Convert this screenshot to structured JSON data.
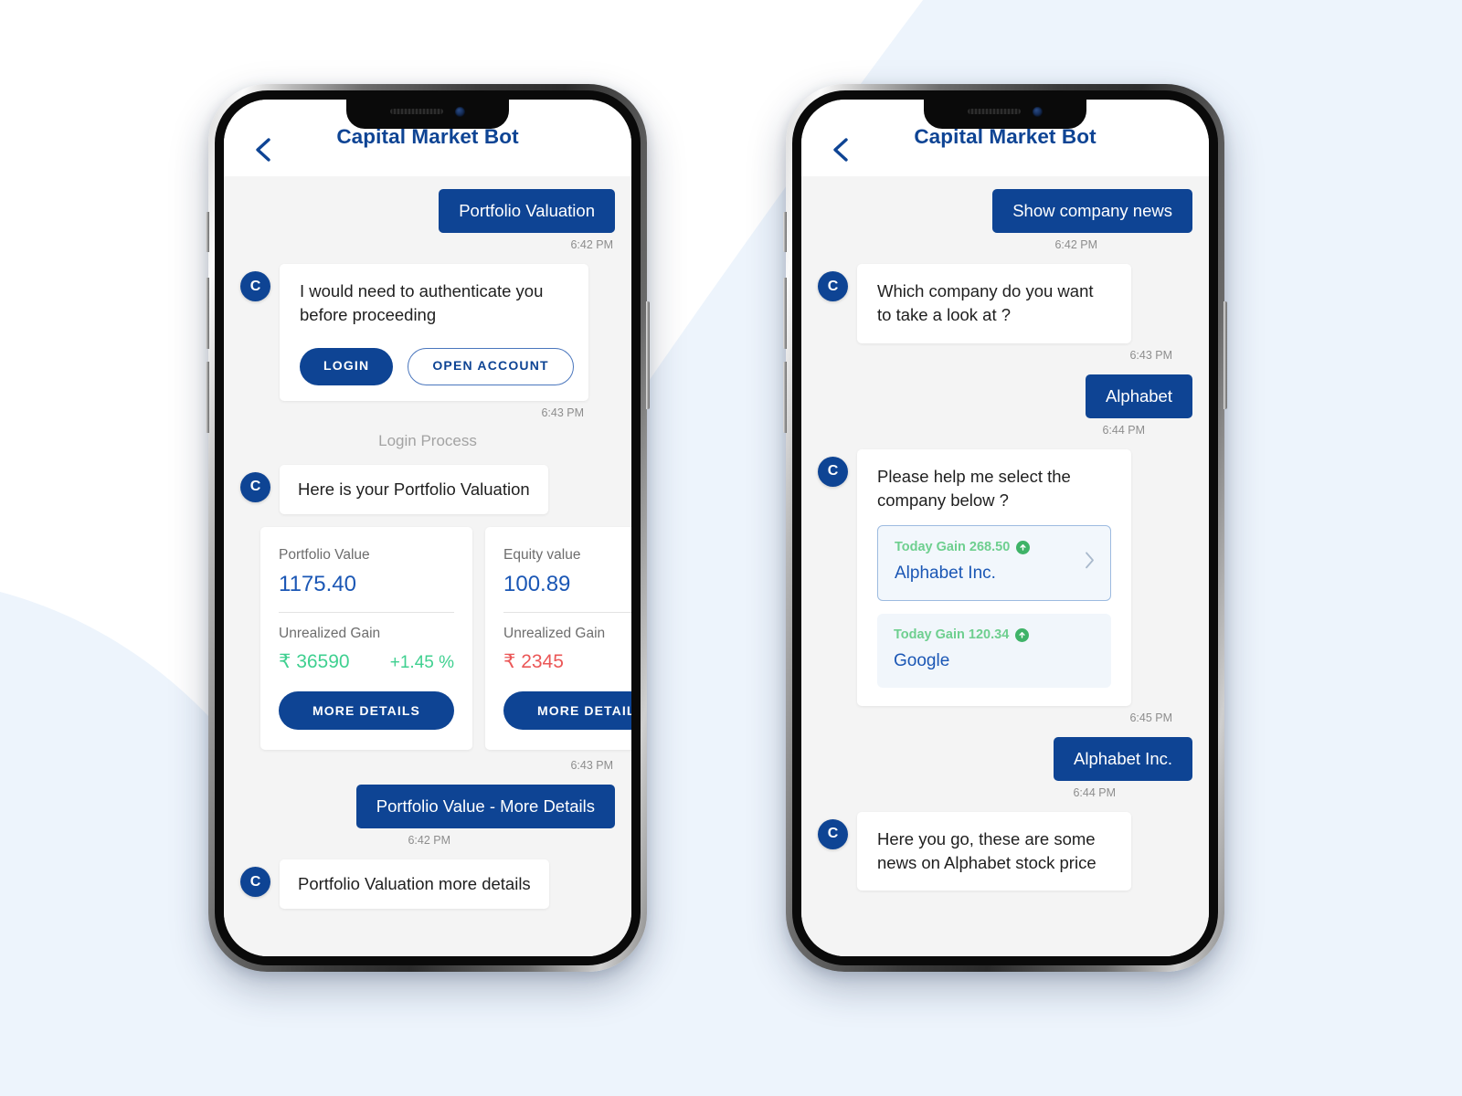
{
  "background": {
    "page_bg": "#ffffff",
    "accent_tint": "#edf4fc"
  },
  "theme": {
    "brand_blue": "#0e4494",
    "value_blue": "#1b57b5",
    "gain_green": "#3fd090",
    "arrow_green": "#6ecf8f",
    "loss_red": "#eb5757",
    "chat_bg": "#f4f4f4"
  },
  "phones": [
    {
      "id": "phone-portfolio",
      "header": {
        "title": "Capital Market Bot",
        "back_icon": "chevron-left-icon"
      },
      "messages": [
        {
          "kind": "user",
          "text": "Portfolio Valuation",
          "time": "6:42 PM"
        },
        {
          "kind": "bot-actions",
          "avatar": "C",
          "text": "I would need to authenticate you before proceeding",
          "buttons": [
            {
              "label": "LOGIN",
              "style": "filled"
            },
            {
              "label": "OPEN ACCOUNT",
              "style": "outline"
            }
          ],
          "time": "6:43 PM"
        },
        {
          "kind": "divider",
          "text": "Login Process"
        },
        {
          "kind": "bot",
          "avatar": "C",
          "text": "Here is your Portfolio Valuation"
        },
        {
          "kind": "cards",
          "time": "6:43 PM",
          "cards": [
            {
              "label": "Portfolio Value",
              "value": "1175.40",
              "gain_label": "Unrealized Gain",
              "gain_amount": "₹ 36590",
              "gain_percent": "+1.45 %",
              "gain_direction": "positive",
              "button": "MORE DETAILS"
            },
            {
              "label": "Equity value",
              "value": "100.89",
              "gain_label": "Unrealized Gain",
              "gain_amount": "₹ 2345",
              "gain_percent": "",
              "gain_direction": "negative",
              "button": "MORE DETAILS"
            }
          ]
        },
        {
          "kind": "user",
          "text": "Portfolio Value - More Details",
          "time": "6:42 PM"
        },
        {
          "kind": "bot",
          "avatar": "C",
          "text": "Portfolio Valuation more details"
        }
      ]
    },
    {
      "id": "phone-news",
      "header": {
        "title": "Capital Market Bot",
        "back_icon": "chevron-left-icon"
      },
      "messages": [
        {
          "kind": "user",
          "text": "Show company news",
          "time": "6:42 PM"
        },
        {
          "kind": "bot",
          "avatar": "C",
          "text": "Which company do you want to take a look at ?",
          "time": "6:43 PM"
        },
        {
          "kind": "user",
          "text": "Alphabet",
          "time": "6:44 PM"
        },
        {
          "kind": "bot-companies",
          "avatar": "C",
          "text": "Please help me select the company below ?",
          "time": "6:45 PM",
          "companies": [
            {
              "gain_label": "Today Gain 268.50",
              "name": "Alphabet Inc.",
              "selected": true,
              "chevron": "chevron-right-icon",
              "arrow": "arrow-up-icon"
            },
            {
              "gain_label": "Today Gain 120.34",
              "name": "Google",
              "selected": false,
              "chevron": "",
              "arrow": "arrow-up-icon"
            }
          ]
        },
        {
          "kind": "user",
          "text": "Alphabet  Inc.",
          "time": "6:44 PM"
        },
        {
          "kind": "bot",
          "avatar": "C",
          "text": "Here you go, these are some news on Alphabet stock price"
        }
      ]
    }
  ]
}
